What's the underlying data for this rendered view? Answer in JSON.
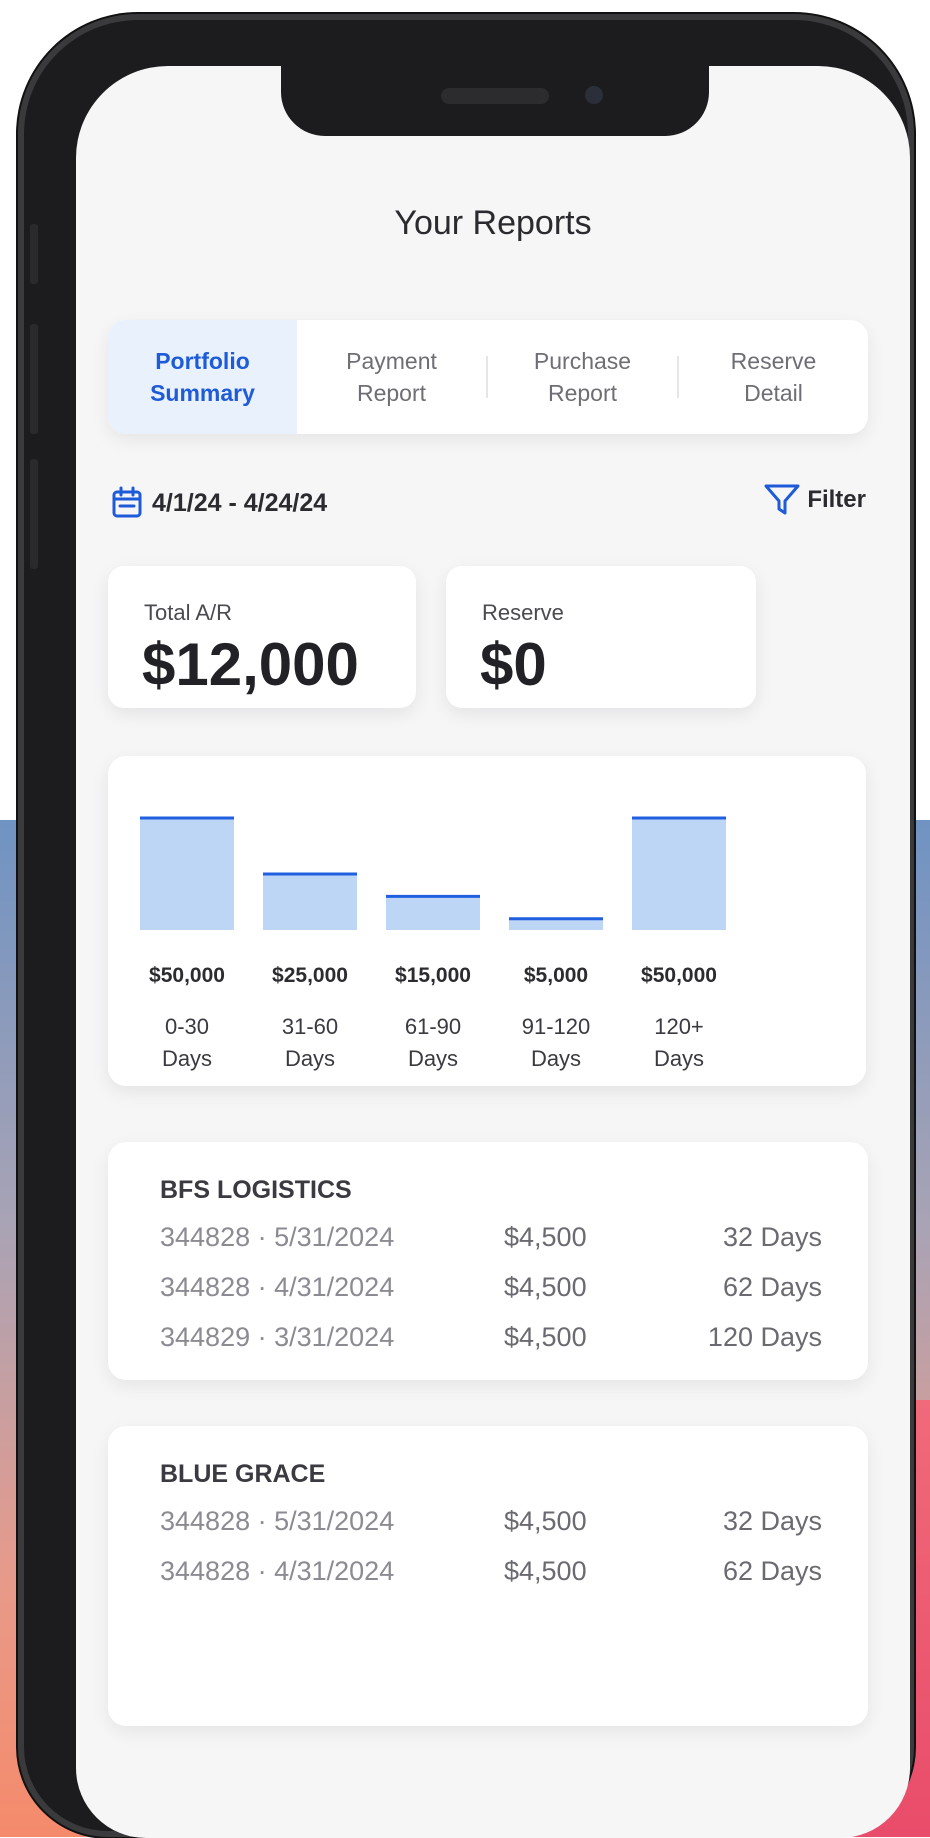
{
  "header": {
    "title": "Your Reports"
  },
  "tabs": [
    {
      "line1": "Portfolio",
      "line2": "Summary"
    },
    {
      "line1": "Payment",
      "line2": "Report"
    },
    {
      "line1": "Purchase",
      "line2": "Report"
    },
    {
      "line1": "Reserve",
      "line2": "Detail"
    }
  ],
  "date_range": "4/1/24 - 4/24/24",
  "filter_label": "Filter",
  "stats": {
    "total_ar": {
      "label": "Total A/R",
      "value": "$12,000"
    },
    "reserve": {
      "label": "Reserve",
      "value": "$0"
    }
  },
  "colors": {
    "accent": "#1e5bd8",
    "bar_fill": "#bdd6f6",
    "bar_line": "#1f5fe0"
  },
  "chart_data": {
    "type": "bar",
    "categories": [
      [
        "0-30",
        "Days"
      ],
      [
        "31-60",
        "Days"
      ],
      [
        "61-90",
        "Days"
      ],
      [
        "91-120",
        "Days"
      ],
      [
        "120+",
        "Days"
      ]
    ],
    "values": [
      50000,
      25000,
      15000,
      5000,
      50000
    ],
    "value_labels": [
      "$50,000",
      "$25,000",
      "$15,000",
      "$5,000",
      "$50,000"
    ]
  },
  "accounts": [
    {
      "name": "BFS LOGISTICS",
      "rows": [
        {
          "invoice": "344828 · 5/31/2024",
          "amount": "$4,500",
          "days": "32 Days"
        },
        {
          "invoice": "344828 · 4/31/2024",
          "amount": "$4,500",
          "days": "62 Days"
        },
        {
          "invoice": "344829 · 3/31/2024",
          "amount": "$4,500",
          "days": "120 Days"
        }
      ]
    },
    {
      "name": "BLUE GRACE",
      "rows": [
        {
          "invoice": "344828 · 5/31/2024",
          "amount": "$4,500",
          "days": "32 Days"
        },
        {
          "invoice": "344828 · 4/31/2024",
          "amount": "$4,500",
          "days": "62 Days"
        }
      ]
    }
  ]
}
